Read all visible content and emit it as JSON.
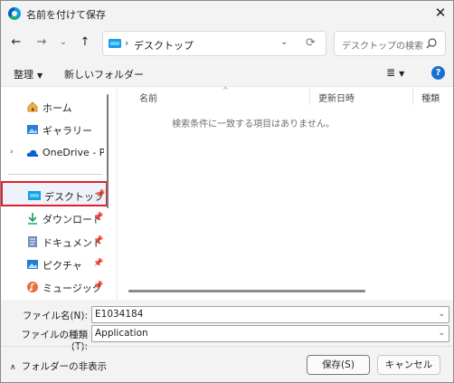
{
  "window": {
    "title": "名前を付けて保存",
    "close_glyph": "✕"
  },
  "nav": {
    "back_glyph": "←",
    "forward_glyph": "→",
    "recent_glyph": "⌄",
    "up_glyph": "↑",
    "address_separator": "›",
    "address_text": "デスクトップ",
    "address_dropdown_glyph": "⌄",
    "refresh_glyph": "⟳",
    "search_placeholder": "デスクトップの検索"
  },
  "toolbar": {
    "organize_label": "整理",
    "caret": "▼",
    "new_folder_label": "新しいフォルダー",
    "view_glyph": "≣",
    "help_glyph": "?"
  },
  "sidebar": {
    "items": [
      {
        "label": "ホーム",
        "icon": "home-icon"
      },
      {
        "label": "ギャラリー",
        "icon": "gallery-icon"
      },
      {
        "label": "OneDrive - Personal",
        "icon": "onedrive-icon",
        "expand_glyph": "›"
      },
      {
        "label": "デスクトップ",
        "icon": "desktop-icon",
        "pin": "📌"
      },
      {
        "label": "ダウンロード",
        "icon": "download-icon",
        "pin": "📌"
      },
      {
        "label": "ドキュメント",
        "icon": "documents-icon",
        "pin": "📌"
      },
      {
        "label": "ピクチャ",
        "icon": "pictures-icon",
        "pin": "📌"
      },
      {
        "label": "ミュージック",
        "icon": "music-icon",
        "pin": "📌"
      }
    ]
  },
  "filelist": {
    "columns": [
      "名前",
      "更新日時",
      "種類"
    ],
    "sort_glyph": "^",
    "empty_message": "検索条件に一致する項目はありません。"
  },
  "form": {
    "filename_label": "ファイル名(N):",
    "filename_value": "E1034184",
    "filetype_label": "ファイルの種類(T):",
    "filetype_value": "Application",
    "dropdown_glyph": "⌄"
  },
  "footer": {
    "hide_folders_label": "フォルダーの非表示",
    "chevron_glyph": "∧",
    "save_label": "保存(S)",
    "cancel_label": "キャンセル"
  },
  "colors": {
    "selection_border": "#e0202c",
    "accent": "#1670d4",
    "desktop_icon": "#1c9be6"
  }
}
